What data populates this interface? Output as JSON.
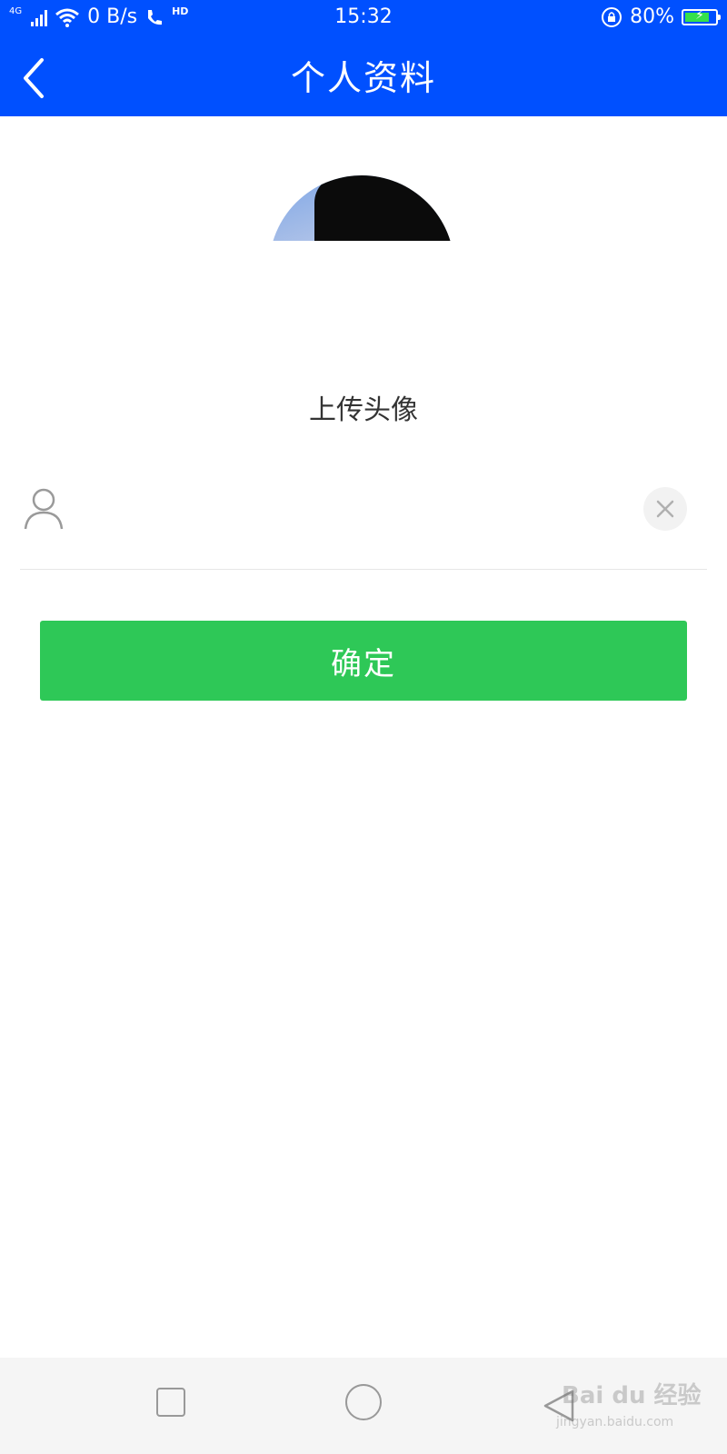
{
  "status_bar": {
    "network": "4G",
    "speed": "0 B/s",
    "call_badge": "HD",
    "time": "15:32",
    "battery": "80%",
    "battery_level": 0.8
  },
  "header": {
    "title": "个人资料",
    "back_icon": "chevron-left-icon"
  },
  "profile": {
    "upload_label": "上传头像",
    "name_value": "",
    "confirm_label": "确定"
  },
  "nav_bar": {
    "recent_icon": "square-icon",
    "home_icon": "circle-icon",
    "back_icon": "triangle-back-icon"
  },
  "watermark": {
    "text": "Bai du 经验",
    "url": "jingyan.baidu.com"
  },
  "colors": {
    "header_bg": "#0050ff",
    "confirm_bg": "#2ec857",
    "nav_bg": "#f5f5f5"
  }
}
